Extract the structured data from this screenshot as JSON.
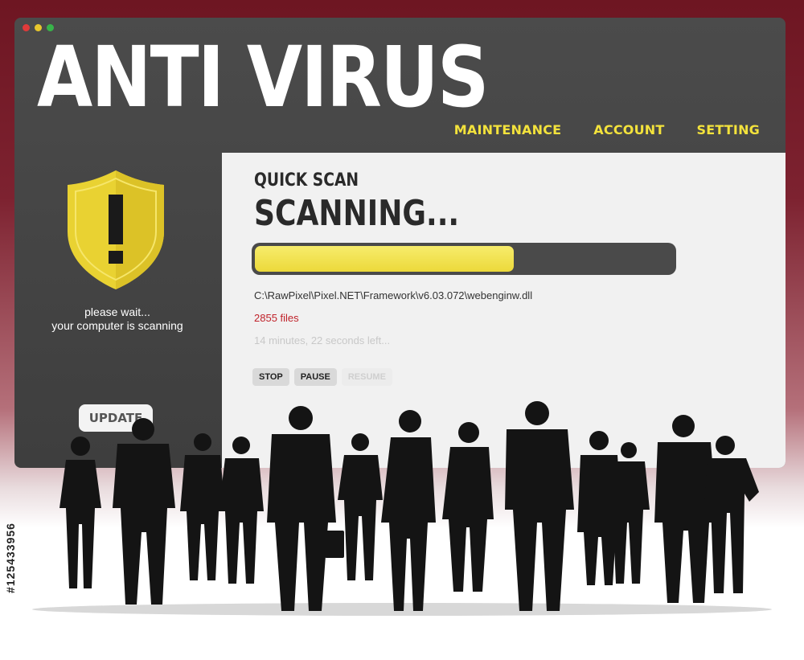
{
  "window": {
    "title": "ANTI VIRUS"
  },
  "nav": {
    "items": [
      "MAINTENANCE",
      "ACCOUNT",
      "SETTING"
    ]
  },
  "sidebar": {
    "icon": "shield-warning-icon",
    "wait_line1": "please wait...",
    "wait_line2": "your computer is scanning",
    "update_label": "UPDATE"
  },
  "scan": {
    "type": "QUICK SCAN",
    "status": "SCANNING...",
    "progress_percent": 62,
    "file_path": "C:\\RawPixel\\Pixel.NET\\Framework\\v6.03.072\\webenginw.dll",
    "files": "2855 files",
    "time_left": "14 minutes, 22 seconds left..."
  },
  "controls": {
    "stop": "STOP",
    "pause": "PAUSE",
    "resume": "RESUME"
  },
  "colors": {
    "accent_yellow": "#f3e23c",
    "progress_fill": "#ecd93a",
    "count_red": "#c0222a",
    "window_bg": "#444444",
    "backdrop": "#7d2230"
  },
  "image_id": "#125433956"
}
